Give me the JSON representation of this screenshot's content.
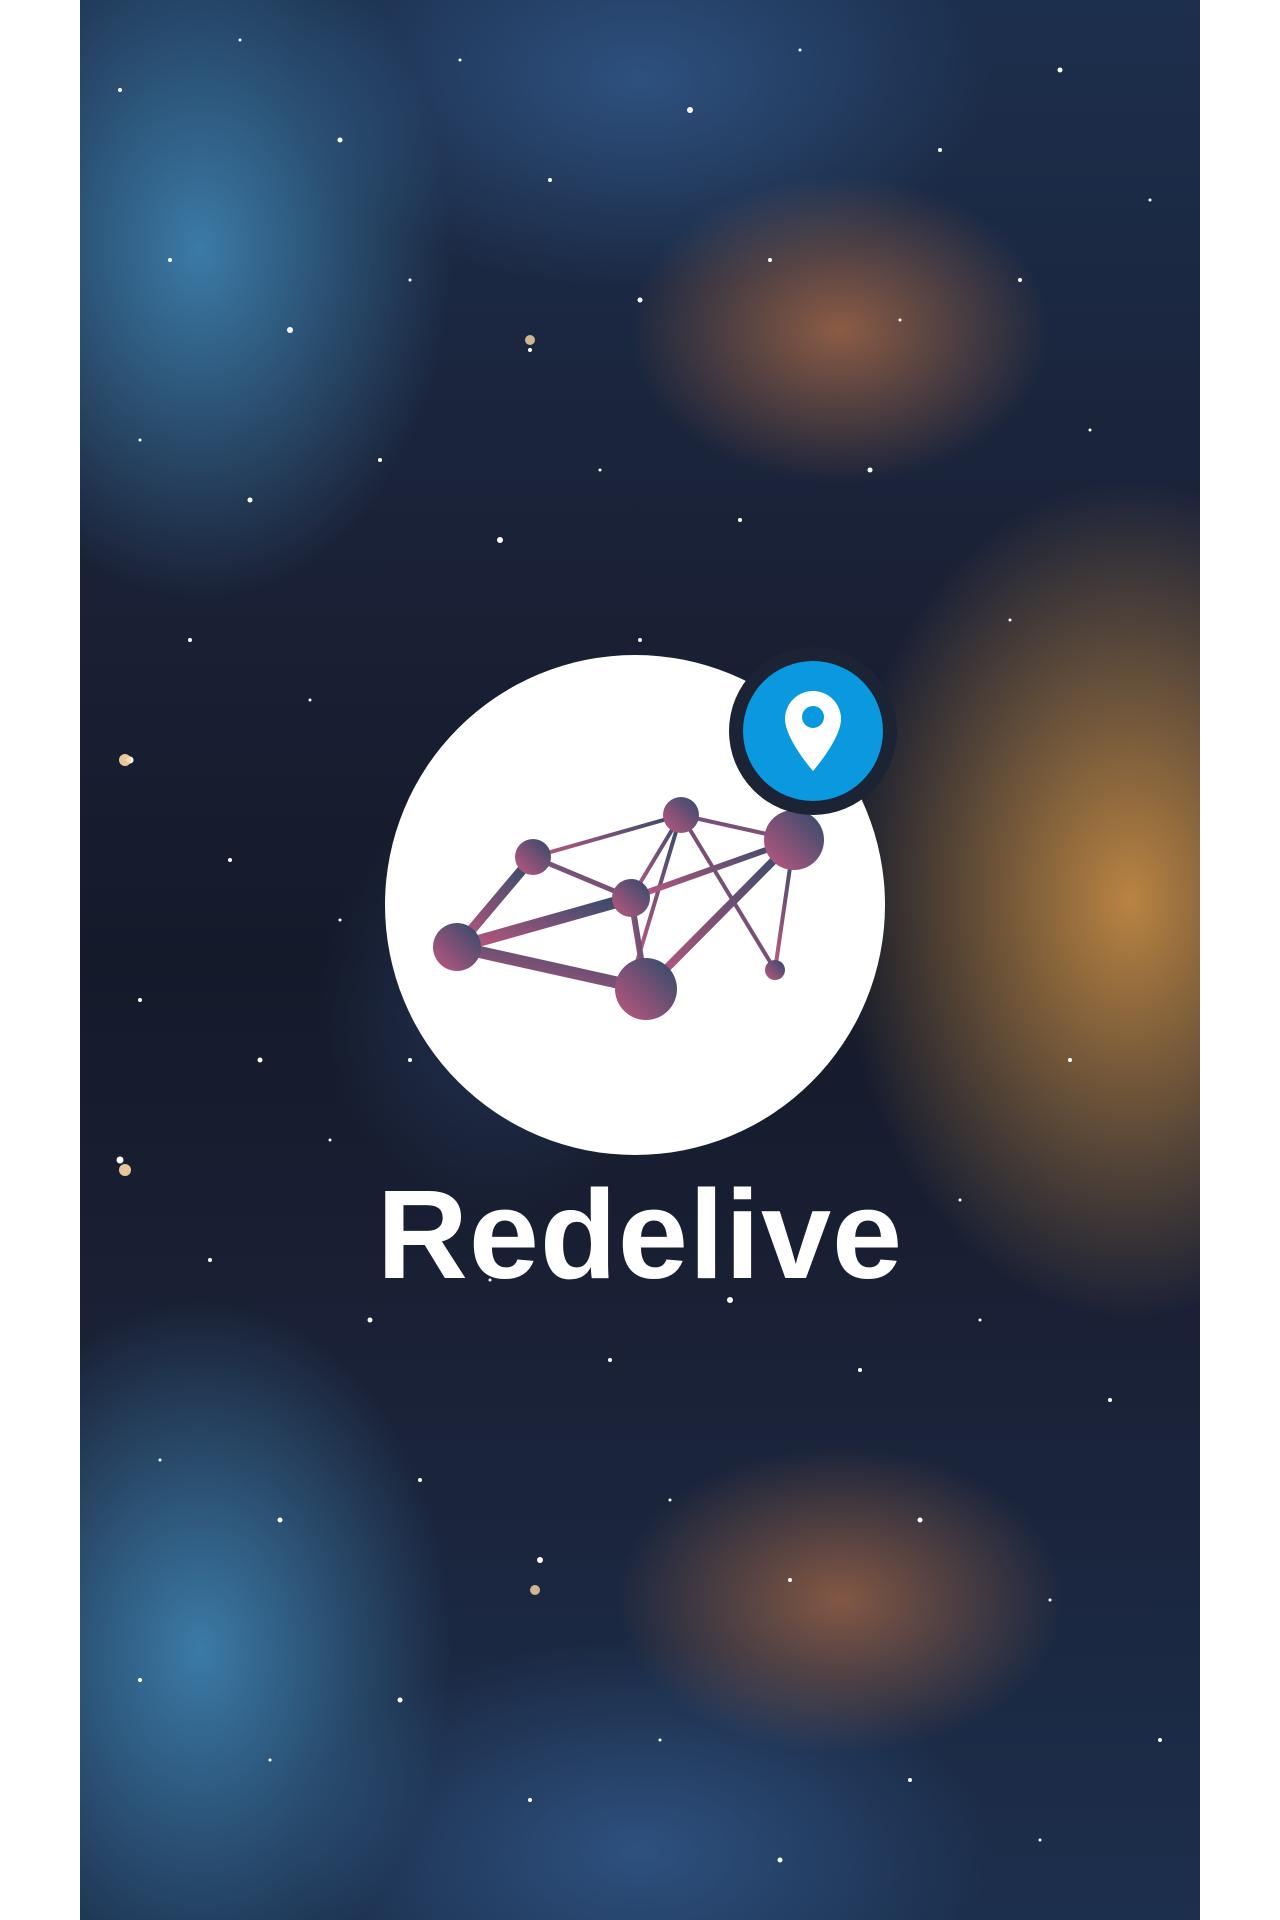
{
  "app": {
    "name": "Redelive"
  },
  "logo": {
    "icon": "network-graph-icon",
    "badge_icon": "location-pin-icon",
    "colors": {
      "circle": "#ffffff",
      "badge": "#0a98df",
      "graph_start": "#c0577f",
      "graph_end": "#2f4a6b"
    }
  },
  "background": {
    "description_icon": "nebula-background",
    "colors": {
      "deep_space": "#141a2a",
      "blue_gas": "#4696c8",
      "orange_gas": "#d69646"
    }
  }
}
